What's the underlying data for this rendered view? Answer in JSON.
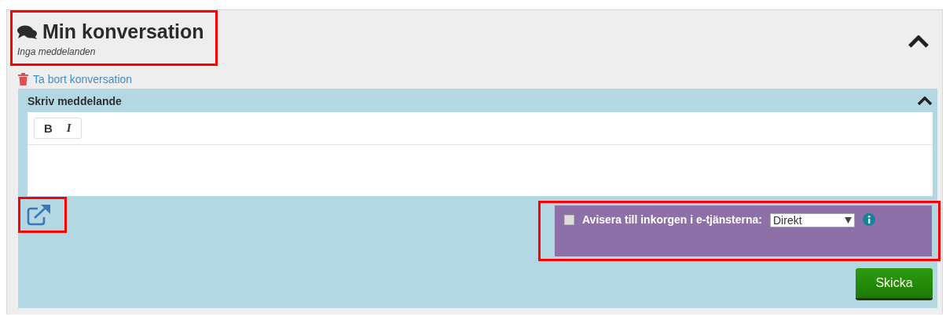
{
  "conversation": {
    "title": "Min konversation",
    "subtitle": "Inga meddelanden",
    "highlighted": true,
    "expanded": true
  },
  "delete_link": "Ta bort konversation",
  "compose": {
    "title": "Skriv meddelande",
    "expanded": true,
    "toolbar": [
      {
        "label": "B",
        "kind": "bold"
      },
      {
        "label": "I",
        "kind": "italic"
      }
    ],
    "popout_highlighted": true
  },
  "notify": {
    "checked": false,
    "label": "Avisera till inkorgen i e-tjänsterna:",
    "select_value": "Direkt",
    "highlighted": true
  },
  "send_button": "Skicka"
}
